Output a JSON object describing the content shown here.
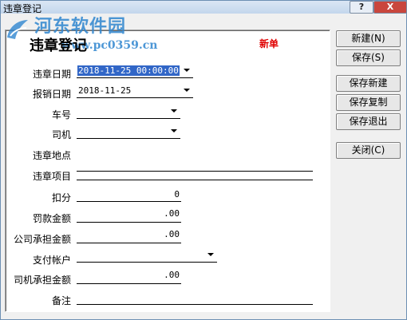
{
  "window": {
    "title": "违章登记",
    "help_label": "?",
    "close_label": "X"
  },
  "watermark": {
    "title": "河东软件园",
    "url": "www.pc0359.cn"
  },
  "form": {
    "heading": "违章登记",
    "status_tag": "新单",
    "fields": {
      "violation_date": {
        "label": "违章日期",
        "value": "2018-11-25 00:00:00"
      },
      "reimburse_date": {
        "label": "报销日期",
        "value": "2018-11-25"
      },
      "car_no": {
        "label": "车号",
        "value": ""
      },
      "driver": {
        "label": "司机",
        "value": ""
      },
      "location": {
        "label": "违章地点",
        "value": ""
      },
      "item": {
        "label": "违章项目",
        "value": ""
      },
      "points": {
        "label": "扣分",
        "value": "0"
      },
      "fine": {
        "label": "罚款金额",
        "value": ".00"
      },
      "company_share": {
        "label": "公司承担金额",
        "value": ".00"
      },
      "pay_account": {
        "label": "支付帐户",
        "value": ""
      },
      "driver_share": {
        "label": "司机承担金额",
        "value": ".00"
      },
      "remark": {
        "label": "备注",
        "value": ""
      }
    }
  },
  "buttons": {
    "new": "新建(N)",
    "save": "保存(S)",
    "save_new": "保存新建",
    "save_copy": "保存复制",
    "save_exit": "保存退出",
    "close": "关闭(C)"
  },
  "colors": {
    "accent_red": "#e00000",
    "selection_blue": "#3166c7",
    "watermark_blue": "#2f86cf"
  }
}
